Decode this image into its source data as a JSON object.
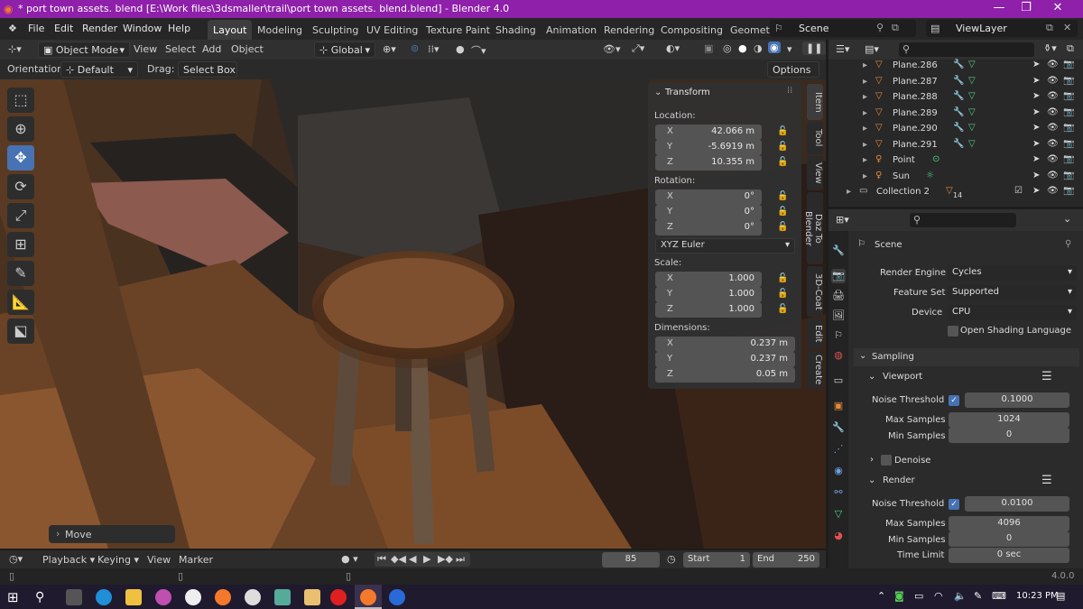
{
  "window": {
    "title": "* port town assets. blend [E:\\Work files\\3dsmaller\\trail\\port town assets. blend.blend] - Blender 4.0",
    "minimize": "—",
    "maximize": "❐",
    "close": "✕"
  },
  "menu": [
    "File",
    "Edit",
    "Render",
    "Window",
    "Help"
  ],
  "workspaces": [
    "Layout",
    "Modeling",
    "Sculpting",
    "UV Editing",
    "Texture Paint",
    "Shading",
    "Animation",
    "Rendering",
    "Compositing",
    "Geomet"
  ],
  "scene": "Scene",
  "view_layer": "ViewLayer",
  "viewport_header": {
    "mode": "Object Mode",
    "view": "View",
    "select": "Select",
    "add": "Add",
    "object": "Object",
    "transform": "Global"
  },
  "tool_settings": {
    "orientation_label": "Orientation:",
    "orientation": "Default",
    "drag_label": "Drag:",
    "drag": "Select Box",
    "options": "Options"
  },
  "npanel": {
    "title": "Transform",
    "location_label": "Location:",
    "location": [
      {
        "axis": "X",
        "value": "42.066 m"
      },
      {
        "axis": "Y",
        "value": "-5.6919 m"
      },
      {
        "axis": "Z",
        "value": "10.355 m"
      }
    ],
    "rotation_label": "Rotation:",
    "rotation": [
      {
        "axis": "X",
        "value": "0°"
      },
      {
        "axis": "Y",
        "value": "0°"
      },
      {
        "axis": "Z",
        "value": "0°"
      }
    ],
    "rotation_mode": "XYZ Euler",
    "scale_label": "Scale:",
    "scale": [
      {
        "axis": "X",
        "value": "1.000"
      },
      {
        "axis": "Y",
        "value": "1.000"
      },
      {
        "axis": "Z",
        "value": "1.000"
      }
    ],
    "dimensions_label": "Dimensions:",
    "dimensions": [
      {
        "axis": "X",
        "value": "0.237 m"
      },
      {
        "axis": "Y",
        "value": "0.237 m"
      },
      {
        "axis": "Z",
        "value": "0.05 m"
      }
    ]
  },
  "sidebar_tabs": [
    "Item",
    "Tool",
    "View",
    "Daz To Blender",
    "3D-Coat",
    "Edit",
    "Create"
  ],
  "operator_panel": "Move",
  "outliner": [
    {
      "name": "Plane.286"
    },
    {
      "name": "Plane.287"
    },
    {
      "name": "Plane.288"
    },
    {
      "name": "Plane.289"
    },
    {
      "name": "Plane.290"
    },
    {
      "name": "Plane.291"
    },
    {
      "name": "Point"
    },
    {
      "name": "Sun"
    },
    {
      "name": "Collection 2",
      "badge": "14"
    }
  ],
  "properties": {
    "scene_name": "Scene",
    "render_engine_label": "Render Engine",
    "render_engine": "Cycles",
    "feature_set_label": "Feature Set",
    "feature_set": "Supported",
    "device_label": "Device",
    "device": "CPU",
    "osl_label": "Open Shading Language",
    "sampling_label": "Sampling",
    "viewport_label": "Viewport",
    "vp_noise_label": "Noise Threshold",
    "vp_noise": "0.1000",
    "vp_max_label": "Max Samples",
    "vp_max": "1024",
    "vp_min_label": "Min Samples",
    "vp_min": "0",
    "denoise_label": "Denoise",
    "render_label": "Render",
    "r_noise_label": "Noise Threshold",
    "r_noise": "0.0100",
    "r_max_label": "Max Samples",
    "r_max": "4096",
    "r_min_label": "Min Samples",
    "r_min": "0",
    "time_limit_label": "Time Limit",
    "time_limit": "0 sec"
  },
  "timeline": {
    "playback": "Playback",
    "keying": "Keying",
    "view": "View",
    "marker": "Marker",
    "frame": "85",
    "start_label": "Start",
    "start": "1",
    "end_label": "End",
    "end": "250"
  },
  "status": {
    "version": "4.0.0"
  },
  "taskbar": {
    "time": "10:23 PM"
  },
  "colors": {
    "title_bar": "#8e20a9",
    "accent": "#4772b3",
    "object_orange": "#e8883a",
    "modifier_blue": "#6ea0e0",
    "mesh_green": "#4fcf8a"
  }
}
